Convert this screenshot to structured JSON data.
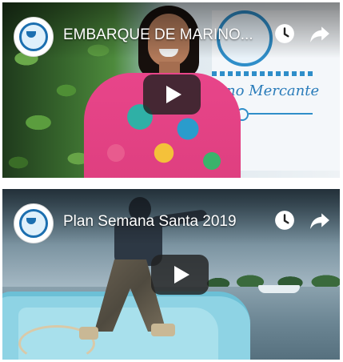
{
  "videos": [
    {
      "title": "EMBARQUE DE MARINO...",
      "banner_text": "no Mercante",
      "icons": {
        "avatar": "channel-emblem-icon",
        "watch_later": "clock-icon",
        "share": "share-arrow-icon",
        "play": "play-icon"
      }
    },
    {
      "title": "Plan Semana Santa 2019",
      "icons": {
        "avatar": "channel-emblem-icon",
        "watch_later": "clock-icon",
        "share": "share-arrow-icon",
        "play": "play-icon"
      }
    }
  ],
  "colors": {
    "overlay_text": "#ffffff",
    "play_bg": "#212121",
    "banner_blue": "#2a7cba"
  }
}
